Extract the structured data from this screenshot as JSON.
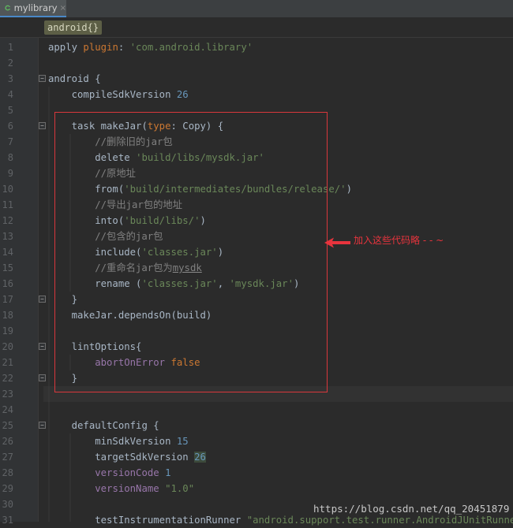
{
  "tab": {
    "title": "mylibrary",
    "close": "×"
  },
  "breadcrumb": "android{}",
  "annotation": {
    "text": "加入这些代码略 - - ~"
  },
  "watermark": "https://blog.csdn.net/qq_20451879",
  "lines": [
    {
      "n": "1",
      "tokens": [
        [
          "txt",
          "apply "
        ],
        [
          "kw",
          "plugin"
        ],
        [
          "txt",
          ": "
        ],
        [
          "str",
          "'com.android.library'"
        ]
      ]
    },
    {
      "n": "2",
      "tokens": []
    },
    {
      "n": "3",
      "fold": "open",
      "tokens": [
        [
          "txt",
          "android {"
        ]
      ]
    },
    {
      "n": "4",
      "tokens": [
        [
          "txt",
          "    compileSdkVersion "
        ],
        [
          "num",
          "26"
        ]
      ]
    },
    {
      "n": "5",
      "tokens": []
    },
    {
      "n": "6",
      "fold": "open",
      "tokens": [
        [
          "txt",
          "    task makeJar("
        ],
        [
          "kw",
          "type"
        ],
        [
          "txt",
          ": Copy) {"
        ]
      ]
    },
    {
      "n": "7",
      "tokens": [
        [
          "cmt",
          "        //删除旧的jar包"
        ]
      ]
    },
    {
      "n": "8",
      "tokens": [
        [
          "txt",
          "        delete "
        ],
        [
          "str",
          "'build/libs/mysdk.jar'"
        ]
      ]
    },
    {
      "n": "9",
      "tokens": [
        [
          "cmt",
          "        //原地址"
        ]
      ]
    },
    {
      "n": "10",
      "tokens": [
        [
          "txt",
          "        from("
        ],
        [
          "str",
          "'build/intermediates/bundles/release/'"
        ],
        [
          "txt",
          ")"
        ]
      ]
    },
    {
      "n": "11",
      "tokens": [
        [
          "cmt",
          "        //导出jar包的地址"
        ]
      ]
    },
    {
      "n": "12",
      "tokens": [
        [
          "txt",
          "        into("
        ],
        [
          "str",
          "'build/libs/'"
        ],
        [
          "txt",
          ")"
        ]
      ]
    },
    {
      "n": "13",
      "tokens": [
        [
          "cmt",
          "        //包含的jar包"
        ]
      ]
    },
    {
      "n": "14",
      "tokens": [
        [
          "txt",
          "        include("
        ],
        [
          "str",
          "'classes.jar'"
        ],
        [
          "txt",
          ")"
        ]
      ]
    },
    {
      "n": "15",
      "tokens": [
        [
          "cmt",
          "        //重命名jar包为"
        ],
        [
          "cmt ul",
          "mysdk"
        ]
      ]
    },
    {
      "n": "16",
      "tokens": [
        [
          "txt",
          "        rename ("
        ],
        [
          "str",
          "'classes.jar'"
        ],
        [
          "txt",
          ", "
        ],
        [
          "str",
          "'mysdk.jar'"
        ],
        [
          "txt",
          ")"
        ]
      ]
    },
    {
      "n": "17",
      "fold": "close",
      "tokens": [
        [
          "txt",
          "    }"
        ]
      ]
    },
    {
      "n": "18",
      "tokens": [
        [
          "txt",
          "    makeJar.dependsOn(build)"
        ]
      ]
    },
    {
      "n": "19",
      "tokens": []
    },
    {
      "n": "20",
      "fold": "open",
      "tokens": [
        [
          "txt",
          "    lintOptions{"
        ]
      ]
    },
    {
      "n": "21",
      "tokens": [
        [
          "txt",
          "        "
        ],
        [
          "prop",
          "abortOnError"
        ],
        [
          "txt",
          " "
        ],
        [
          "kw",
          "false"
        ]
      ]
    },
    {
      "n": "22",
      "fold": "close",
      "tokens": [
        [
          "txt",
          "    }"
        ]
      ]
    },
    {
      "n": "23",
      "tokens": []
    },
    {
      "n": "24",
      "tokens": []
    },
    {
      "n": "25",
      "fold": "open",
      "tokens": [
        [
          "txt",
          "    defaultConfig {"
        ]
      ]
    },
    {
      "n": "26",
      "tokens": [
        [
          "txt",
          "        minSdkVersion "
        ],
        [
          "num",
          "15"
        ]
      ]
    },
    {
      "n": "27",
      "tokens": [
        [
          "txt",
          "        targetSdkVersion "
        ],
        [
          "num hl",
          "26"
        ]
      ]
    },
    {
      "n": "28",
      "tokens": [
        [
          "txt",
          "        "
        ],
        [
          "prop",
          "versionCode "
        ],
        [
          "num",
          "1"
        ]
      ]
    },
    {
      "n": "29",
      "tokens": [
        [
          "txt",
          "        "
        ],
        [
          "prop",
          "versionName "
        ],
        [
          "str",
          "\"1.0\""
        ]
      ]
    },
    {
      "n": "30",
      "tokens": []
    },
    {
      "n": "31",
      "tokens": [
        [
          "txt",
          "        testInstrumentationRunner "
        ],
        [
          "str",
          "\"android.support.test.runner.AndroidJUnitRunner\""
        ]
      ]
    }
  ],
  "colors": {
    "background": "#2b2b2b",
    "keyword": "#cc7832",
    "string": "#6a8759",
    "number": "#6897bb",
    "comment": "#808080",
    "property": "#9876aa",
    "annotation": "#e8343d"
  }
}
